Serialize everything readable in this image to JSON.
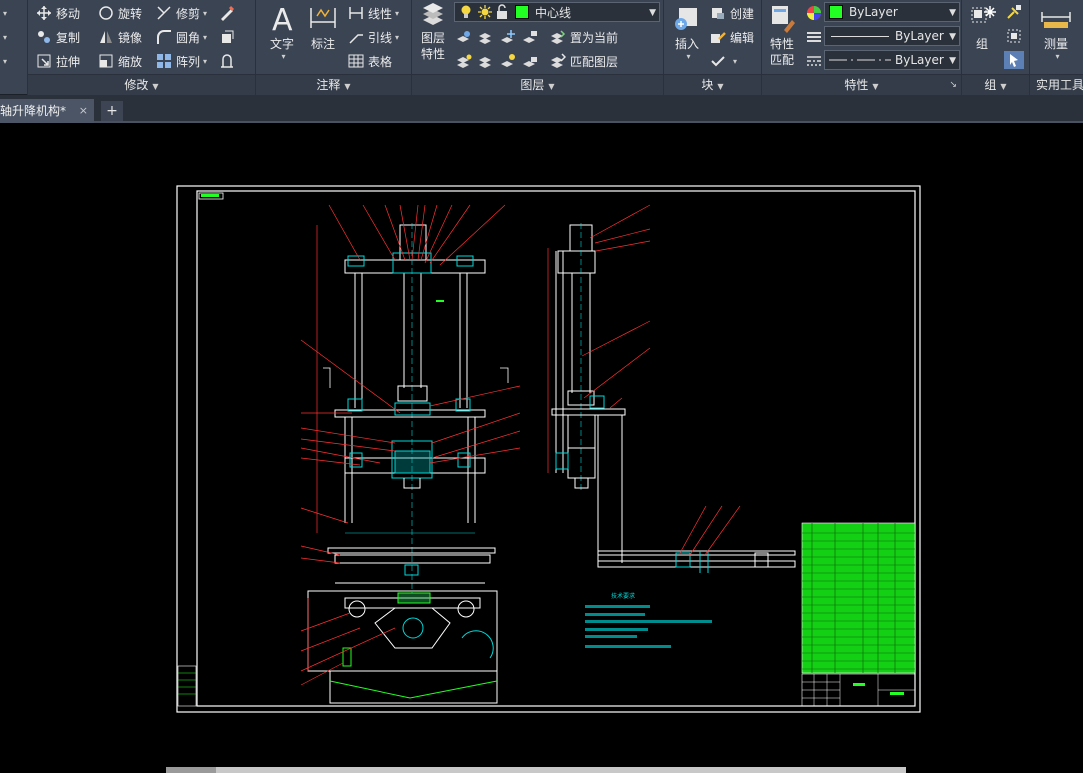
{
  "ribbon": {
    "modify": {
      "title": "修改",
      "move": "移动",
      "rotate": "旋转",
      "trim": "修剪",
      "copy": "复制",
      "mirror": "镜像",
      "fillet": "圆角",
      "stretch": "拉伸",
      "scale": "缩放",
      "array": "阵列"
    },
    "annotation": {
      "title": "注释",
      "text": "文字",
      "dimension": "标注",
      "linear": "线性",
      "leader": "引线",
      "table": "表格"
    },
    "layers": {
      "title": "图层",
      "properties_line1": "图层",
      "properties_line2": "特性",
      "current_layer": "中心线",
      "current_layer_color": "#22ff22",
      "set_current": "置为当前",
      "match_layer": "匹配图层"
    },
    "block": {
      "title": "块",
      "insert": "插入",
      "create": "创建",
      "edit": "编辑"
    },
    "properties": {
      "title": "特性",
      "match_line1": "特性",
      "match_line2": "匹配",
      "color": "ByLayer",
      "color_swatch": "#22ff22",
      "linetype": "ByLayer",
      "lineweight": "ByLayer"
    },
    "groups": {
      "title": "组",
      "group": "组"
    },
    "utilities": {
      "title": "实用工具",
      "measure": "测量"
    }
  },
  "tabs": {
    "document": "轴升降机构*",
    "close": "×",
    "new": "+"
  },
  "drawing": {
    "notes_title": "技术要求"
  }
}
